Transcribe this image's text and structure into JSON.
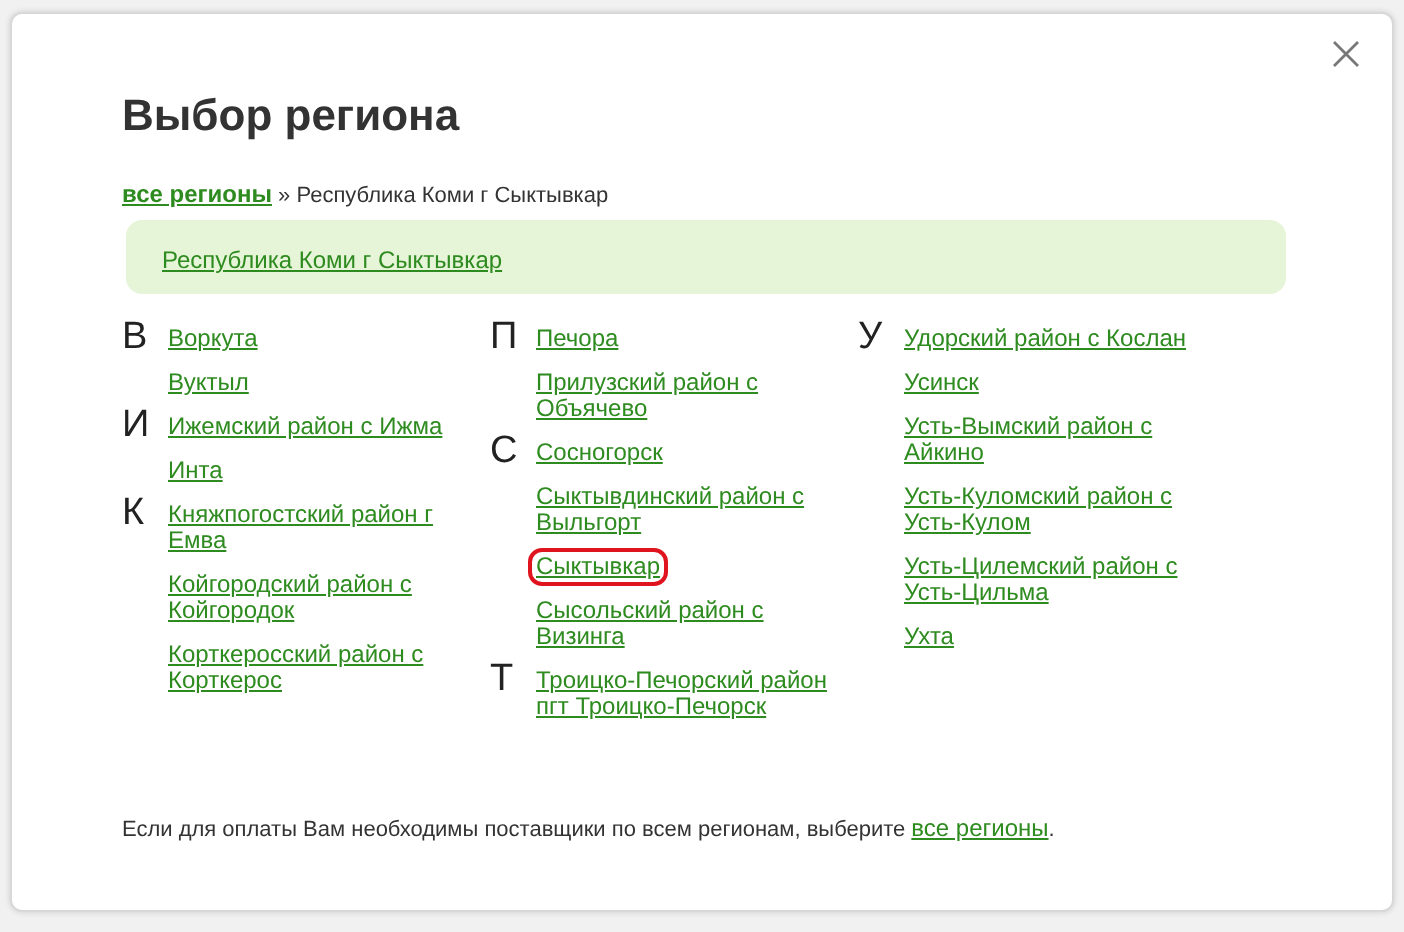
{
  "dialog": {
    "title": "Выбор региона",
    "breadcrumb": {
      "link": "все регионы",
      "separator": "»",
      "current": "Республика Коми г Сыктывкар"
    },
    "current_region": "Республика Коми г Сыктывкар",
    "columns": [
      {
        "groups": [
          {
            "letter": "В",
            "items": [
              {
                "label": "Воркута",
                "selected": false
              },
              {
                "label": "Вуктыл",
                "selected": false
              }
            ]
          },
          {
            "letter": "И",
            "items": [
              {
                "label": "Ижемский район с Ижма",
                "selected": false
              },
              {
                "label": "Инта",
                "selected": false
              }
            ]
          },
          {
            "letter": "К",
            "items": [
              {
                "label": "Княжпогостский район г Емва",
                "selected": false
              },
              {
                "label": "Койгородский район с Койгородок",
                "selected": false
              },
              {
                "label": "Корткеросский район с Корткерос",
                "selected": false
              }
            ]
          }
        ]
      },
      {
        "groups": [
          {
            "letter": "П",
            "items": [
              {
                "label": "Печора",
                "selected": false
              },
              {
                "label": "Прилузский район с Объячево",
                "selected": false
              }
            ]
          },
          {
            "letter": "С",
            "items": [
              {
                "label": "Сосногорск",
                "selected": false
              },
              {
                "label": "Сыктывдинский район с Выльгорт",
                "selected": false
              },
              {
                "label": "Сыктывкар",
                "selected": true
              },
              {
                "label": "Сысольский район с Визинга",
                "selected": false
              }
            ]
          },
          {
            "letter": "Т",
            "items": [
              {
                "label": "Троицко-Печорский район пгт Троицко-Печорск",
                "selected": false
              }
            ]
          }
        ]
      },
      {
        "groups": [
          {
            "letter": "У",
            "items": [
              {
                "label": "Удорский район с Кослан",
                "selected": false
              },
              {
                "label": "Усинск",
                "selected": false
              },
              {
                "label": "Усть-Вымский район с Айкино",
                "selected": false
              },
              {
                "label": "Усть-Куломский район с Усть-Кулом",
                "selected": false
              },
              {
                "label": "Усть-Цилемский район с Усть-Цильма",
                "selected": false
              },
              {
                "label": "Ухта",
                "selected": false
              }
            ]
          }
        ]
      }
    ],
    "footer": {
      "text": "Если для оплаты Вам необходимы поставщики по всем регионам, выберите",
      "link": "все регионы",
      "end": "."
    }
  }
}
